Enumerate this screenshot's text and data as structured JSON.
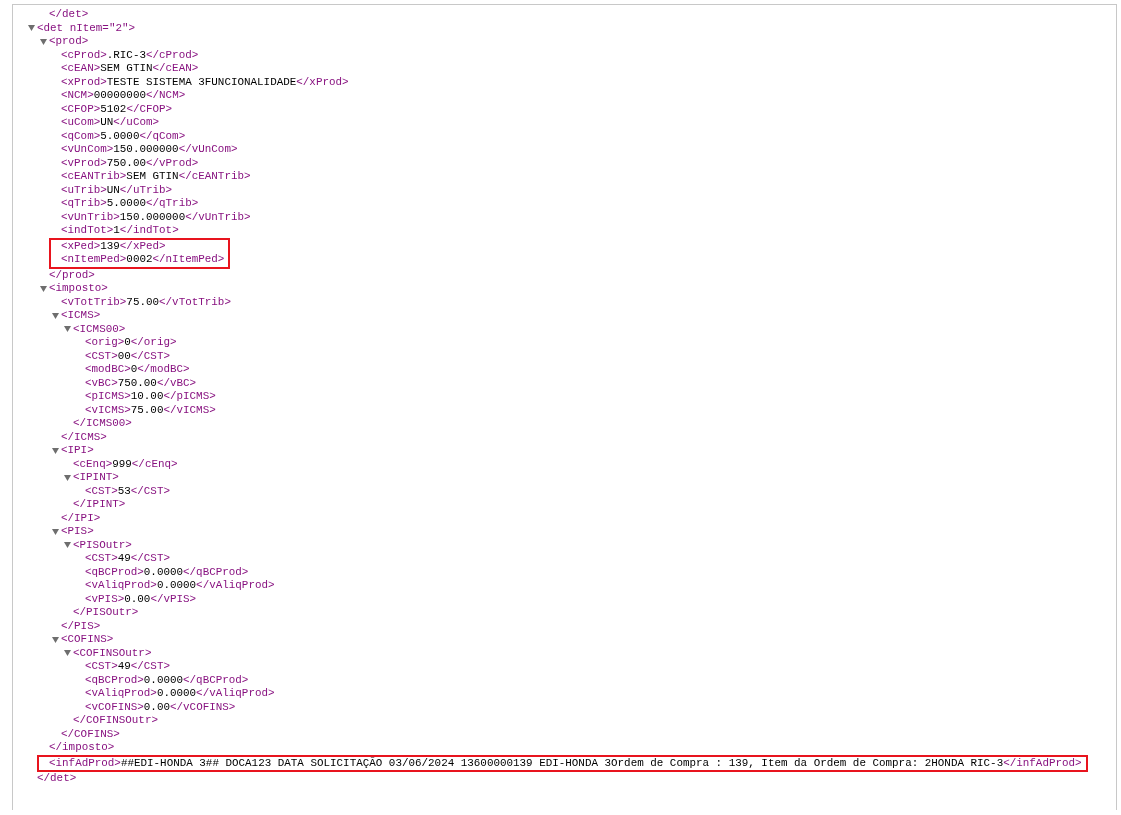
{
  "leading_close_tag": "</det>",
  "root": {
    "kind": "element",
    "open_tag": "<det nItem=\"2\">",
    "close_tag": "</det>",
    "expanded": true,
    "children": [
      {
        "kind": "element",
        "open_tag": "<prod>",
        "close_tag": "</prod>",
        "expanded": true,
        "children": [
          {
            "kind": "leaf",
            "open_tag": "<cProd>",
            "text": ".RIC-3",
            "close_tag": "</cProd>"
          },
          {
            "kind": "leaf",
            "open_tag": "<cEAN>",
            "text": "SEM GTIN",
            "close_tag": "</cEAN>"
          },
          {
            "kind": "leaf",
            "open_tag": "<xProd>",
            "text": "TESTE SISTEMA 3FUNCIONALIDADE",
            "close_tag": "</xProd>"
          },
          {
            "kind": "leaf",
            "open_tag": "<NCM>",
            "text": "00000000",
            "close_tag": "</NCM>"
          },
          {
            "kind": "leaf",
            "open_tag": "<CFOP>",
            "text": "5102",
            "close_tag": "</CFOP>"
          },
          {
            "kind": "leaf",
            "open_tag": "<uCom>",
            "text": "UN",
            "close_tag": "</uCom>"
          },
          {
            "kind": "leaf",
            "open_tag": "<qCom>",
            "text": "5.0000",
            "close_tag": "</qCom>"
          },
          {
            "kind": "leaf",
            "open_tag": "<vUnCom>",
            "text": "150.000000",
            "close_tag": "</vUnCom>"
          },
          {
            "kind": "leaf",
            "open_tag": "<vProd>",
            "text": "750.00",
            "close_tag": "</vProd>"
          },
          {
            "kind": "leaf",
            "open_tag": "<cEANTrib>",
            "text": "SEM GTIN",
            "close_tag": "</cEANTrib>"
          },
          {
            "kind": "leaf",
            "open_tag": "<uTrib>",
            "text": "UN",
            "close_tag": "</uTrib>"
          },
          {
            "kind": "leaf",
            "open_tag": "<qTrib>",
            "text": "5.0000",
            "close_tag": "</qTrib>"
          },
          {
            "kind": "leaf",
            "open_tag": "<vUnTrib>",
            "text": "150.000000",
            "close_tag": "</vUnTrib>"
          },
          {
            "kind": "leaf",
            "open_tag": "<indTot>",
            "text": "1",
            "close_tag": "</indTot>"
          },
          {
            "kind": "highlight",
            "children": [
              {
                "kind": "leaf",
                "open_tag": "<xPed>",
                "text": "139",
                "close_tag": "</xPed>"
              },
              {
                "kind": "leaf",
                "open_tag": "<nItemPed>",
                "text": "0002",
                "close_tag": "</nItemPed>"
              }
            ]
          }
        ]
      },
      {
        "kind": "element",
        "open_tag": "<imposto>",
        "close_tag": "</imposto>",
        "expanded": true,
        "children": [
          {
            "kind": "leaf",
            "open_tag": "<vTotTrib>",
            "text": "75.00",
            "close_tag": "</vTotTrib>"
          },
          {
            "kind": "element",
            "open_tag": "<ICMS>",
            "close_tag": "</ICMS>",
            "expanded": true,
            "children": [
              {
                "kind": "element",
                "open_tag": "<ICMS00>",
                "close_tag": "</ICMS00>",
                "expanded": true,
                "children": [
                  {
                    "kind": "leaf",
                    "open_tag": "<orig>",
                    "text": "0",
                    "close_tag": "</orig>"
                  },
                  {
                    "kind": "leaf",
                    "open_tag": "<CST>",
                    "text": "00",
                    "close_tag": "</CST>"
                  },
                  {
                    "kind": "leaf",
                    "open_tag": "<modBC>",
                    "text": "0",
                    "close_tag": "</modBC>"
                  },
                  {
                    "kind": "leaf",
                    "open_tag": "<vBC>",
                    "text": "750.00",
                    "close_tag": "</vBC>"
                  },
                  {
                    "kind": "leaf",
                    "open_tag": "<pICMS>",
                    "text": "10.00",
                    "close_tag": "</pICMS>"
                  },
                  {
                    "kind": "leaf",
                    "open_tag": "<vICMS>",
                    "text": "75.00",
                    "close_tag": "</vICMS>"
                  }
                ]
              }
            ]
          },
          {
            "kind": "element",
            "open_tag": "<IPI>",
            "close_tag": "</IPI>",
            "expanded": true,
            "children": [
              {
                "kind": "leaf",
                "open_tag": "<cEnq>",
                "text": "999",
                "close_tag": "</cEnq>"
              },
              {
                "kind": "element",
                "open_tag": "<IPINT>",
                "close_tag": "</IPINT>",
                "expanded": true,
                "children": [
                  {
                    "kind": "leaf",
                    "open_tag": "<CST>",
                    "text": "53",
                    "close_tag": "</CST>"
                  }
                ]
              }
            ]
          },
          {
            "kind": "element",
            "open_tag": "<PIS>",
            "close_tag": "</PIS>",
            "expanded": true,
            "children": [
              {
                "kind": "element",
                "open_tag": "<PISOutr>",
                "close_tag": "</PISOutr>",
                "expanded": true,
                "children": [
                  {
                    "kind": "leaf",
                    "open_tag": "<CST>",
                    "text": "49",
                    "close_tag": "</CST>"
                  },
                  {
                    "kind": "leaf",
                    "open_tag": "<qBCProd>",
                    "text": "0.0000",
                    "close_tag": "</qBCProd>"
                  },
                  {
                    "kind": "leaf",
                    "open_tag": "<vAliqProd>",
                    "text": "0.0000",
                    "close_tag": "</vAliqProd>"
                  },
                  {
                    "kind": "leaf",
                    "open_tag": "<vPIS>",
                    "text": "0.00",
                    "close_tag": "</vPIS>"
                  }
                ]
              }
            ]
          },
          {
            "kind": "element",
            "open_tag": "<COFINS>",
            "close_tag": "</COFINS>",
            "expanded": true,
            "children": [
              {
                "kind": "element",
                "open_tag": "<COFINSOutr>",
                "close_tag": "</COFINSOutr>",
                "expanded": true,
                "children": [
                  {
                    "kind": "leaf",
                    "open_tag": "<CST>",
                    "text": "49",
                    "close_tag": "</CST>"
                  },
                  {
                    "kind": "leaf",
                    "open_tag": "<qBCProd>",
                    "text": "0.0000",
                    "close_tag": "</qBCProd>"
                  },
                  {
                    "kind": "leaf",
                    "open_tag": "<vAliqProd>",
                    "text": "0.0000",
                    "close_tag": "</vAliqProd>"
                  },
                  {
                    "kind": "leaf",
                    "open_tag": "<vCOFINS>",
                    "text": "0.00",
                    "close_tag": "</vCOFINS>"
                  }
                ]
              }
            ]
          }
        ]
      },
      {
        "kind": "highlight",
        "children": [
          {
            "kind": "leaf",
            "open_tag": "<infAdProd>",
            "text": "##EDI-HONDA 3## DOCA123 DATA SOLICITAÇÃO 03/06/2024 13600000139 EDI-HONDA 3Ordem de Compra : 139, Item da Ordem de Compra: 2HONDA RIC-3",
            "close_tag": "</infAdProd>"
          }
        ]
      }
    ]
  }
}
